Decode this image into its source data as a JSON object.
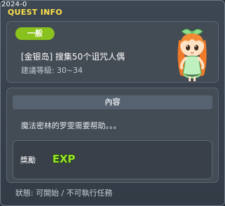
{
  "titlebar": {
    "small": "2024-0",
    "title": "QUEST INFO"
  },
  "quest": {
    "category_badge": "一般",
    "name": "[金银岛] 搜集50个诅咒人偶",
    "level": "建議等級: 30~34"
  },
  "content": {
    "header": "內容",
    "description": "魔法密林的罗雯需要帮助。。。"
  },
  "reward": {
    "label": "獎勵",
    "icon_text": "EXP"
  },
  "status": "狀態: 可開始 / 不可執行任務",
  "colors": {
    "title_accent": "#ffe14a",
    "badge": "#8ac21d",
    "exp_fill": "#9be22c",
    "exp_outline": "#1e4d0a"
  }
}
